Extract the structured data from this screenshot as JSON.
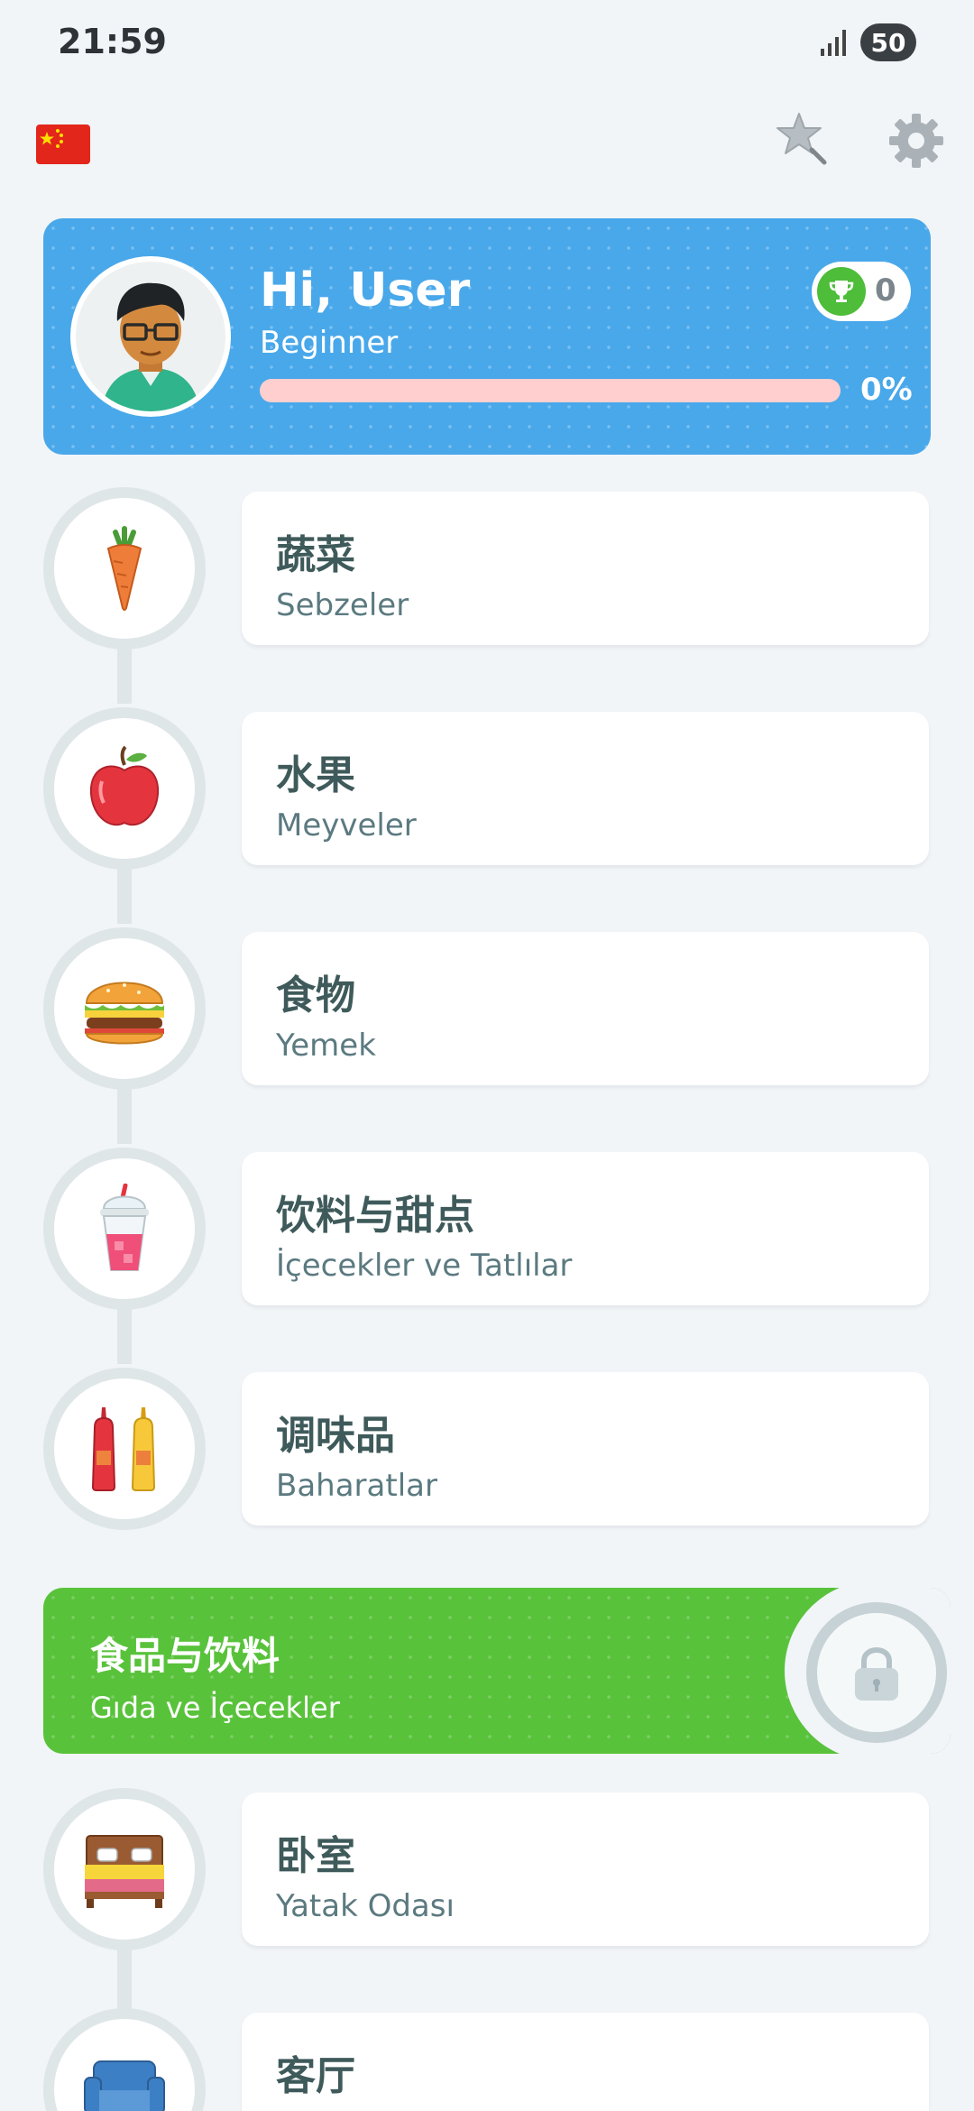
{
  "status_bar": {
    "time": "21:59",
    "battery": "50"
  },
  "top_bar": {
    "flag_icon": "china-flag-icon",
    "badge_icon": "star-badge-icon",
    "settings_icon": "gear-icon"
  },
  "profile": {
    "greeting": "Hi, User",
    "level": "Beginner",
    "progress_label": "0%",
    "progress_fraction": 0,
    "trophies": "0"
  },
  "lessons": [
    {
      "title": "蔬菜",
      "subtitle": "Sebzeler",
      "icon": "carrot-icon"
    },
    {
      "title": "水果",
      "subtitle": "Meyveler",
      "icon": "apple-icon"
    },
    {
      "title": "食物",
      "subtitle": "Yemek",
      "icon": "burger-icon"
    },
    {
      "title": "饮料与甜点",
      "subtitle": "İçecekler ve Tatlılar",
      "icon": "drink-icon"
    },
    {
      "title": "调味品",
      "subtitle": "Baharatlar",
      "icon": "condiments-icon"
    }
  ],
  "section": {
    "title": "食品与饮料",
    "subtitle": "Gıda ve İçecekler",
    "icon": "lock-icon"
  },
  "lessons_2": [
    {
      "title": "卧室",
      "subtitle": "Yatak Odası",
      "icon": "bed-icon"
    },
    {
      "title": "客厅",
      "subtitle": "",
      "icon": "sofa-icon"
    }
  ],
  "colors": {
    "profile_bg": "#49a8ea",
    "section_bg": "#59c23b",
    "trophy_green": "#4dbd3a",
    "progress_track": "#ffcfd0"
  }
}
